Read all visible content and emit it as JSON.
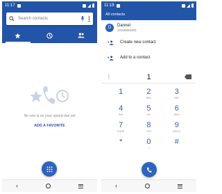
{
  "left_screen": {
    "status_time": "11:17",
    "search_placeholder": "Search contacts",
    "tab_icons": [
      "star-icon",
      "clock-icon",
      "people-icon"
    ],
    "empty_text": "No one is on your speed dial yet",
    "add_favorite_label": "ADD A FAVORITE",
    "fab_icon": "dialpad-icon"
  },
  "right_screen": {
    "status_time": "11:18",
    "header_title": "All contacts",
    "contact": {
      "initial": "D",
      "name": "Dannel",
      "number": "12345693453"
    },
    "actions": [
      {
        "label": "Create new contact",
        "icon": "add-person-icon"
      },
      {
        "label": "Add to a contact",
        "icon": "add-person-icon"
      }
    ],
    "typed_number": "1",
    "keys": [
      {
        "digit": "1",
        "letters": ""
      },
      {
        "digit": "2",
        "letters": "ABC"
      },
      {
        "digit": "3",
        "letters": "DEF"
      },
      {
        "digit": "4",
        "letters": "GHI"
      },
      {
        "digit": "5",
        "letters": "JKL"
      },
      {
        "digit": "6",
        "letters": "MNO"
      },
      {
        "digit": "7",
        "letters": "PQRS"
      },
      {
        "digit": "8",
        "letters": "TUV"
      },
      {
        "digit": "9",
        "letters": "WXYZ"
      },
      {
        "digit": "*",
        "letters": ""
      },
      {
        "digit": "0",
        "letters": "+"
      },
      {
        "digit": "#",
        "letters": ""
      }
    ],
    "call_icon": "phone-icon"
  },
  "colors": {
    "primary": "#2255a8",
    "accent": "#2f63c0",
    "muted_icon": "#c9d3e6"
  }
}
